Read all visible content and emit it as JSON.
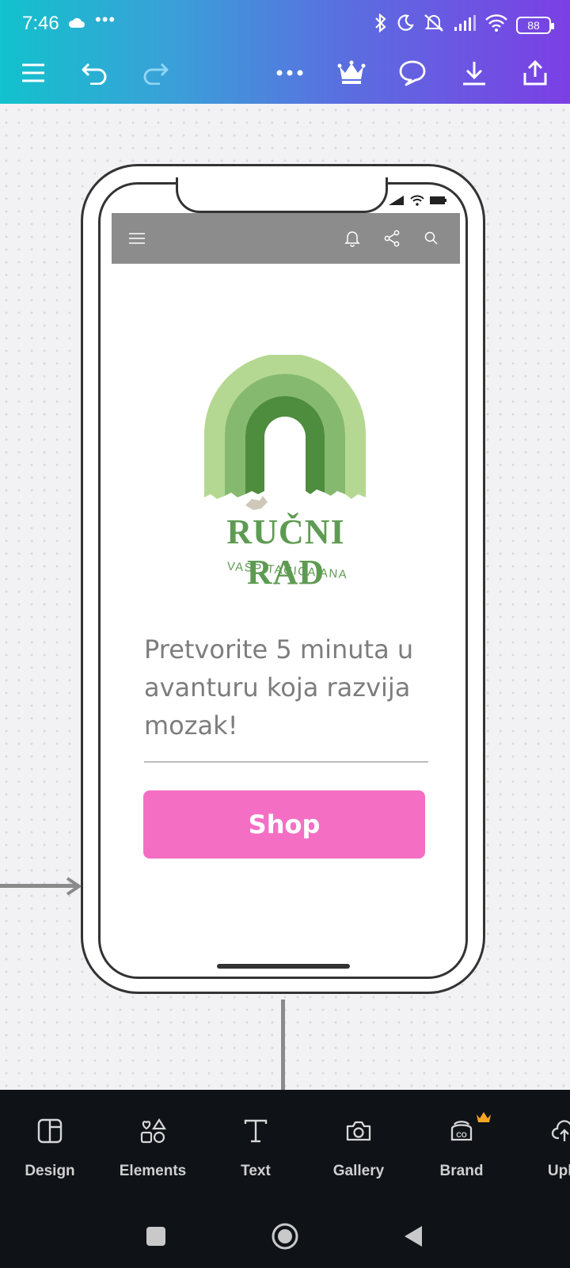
{
  "status_bar": {
    "time": "7:46",
    "battery": "88"
  },
  "toolbar": {
    "menu": "menu-icon",
    "undo": "undo-icon",
    "redo": "redo-icon",
    "more": "more-icon",
    "premium": "crown-icon",
    "comments": "comment-icon",
    "download": "download-icon",
    "share": "share-icon"
  },
  "mockup": {
    "logo_title": "RUČNI RAD",
    "logo_subtitle": "VASPITAČICA ANA",
    "headline": "Pretvorite 5 minuta u avanturu koja razvija mozak!",
    "shop_button": "Shop",
    "colors": {
      "header_bg": "#8c8c8c",
      "button_bg": "#f46fc4",
      "logo_green": "#5e9b52",
      "headline_text": "#7d7d7d"
    }
  },
  "dock": {
    "items": [
      {
        "label": "Design",
        "icon": "design-icon"
      },
      {
        "label": "Elements",
        "icon": "elements-icon"
      },
      {
        "label": "Text",
        "icon": "text-icon"
      },
      {
        "label": "Gallery",
        "icon": "camera-icon"
      },
      {
        "label": "Brand",
        "icon": "brand-icon"
      },
      {
        "label": "Uplo",
        "icon": "upload-icon"
      }
    ]
  },
  "theme": {
    "gradient_start": "#12c2cc",
    "gradient_end": "#7b3fe4",
    "dock_bg": "#0f1217"
  }
}
